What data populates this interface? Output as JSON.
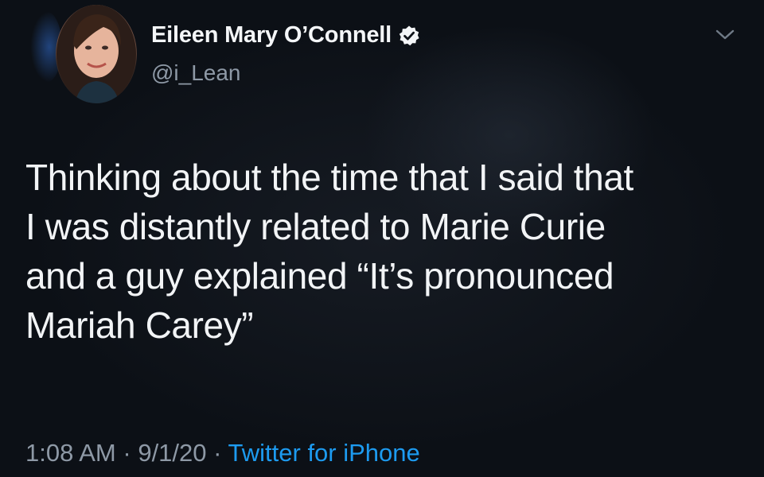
{
  "author": {
    "display_name": "Eileen Mary O’Connell",
    "handle": "@i_Lean",
    "verified": true
  },
  "tweet": {
    "lines": [
      "Thinking about the time that I said that",
      "I was distantly related to Marie Curie",
      "and a guy explained “It’s pronounced",
      "Mariah Carey”"
    ]
  },
  "meta": {
    "time": "1:08 AM",
    "separator": "·",
    "date": "9/1/20",
    "source": "Twitter for iPhone"
  },
  "colors": {
    "background": "#10141a",
    "text": "#f2f4f6",
    "secondary_text": "#8e99a6",
    "link": "#1d9bf0"
  },
  "icons": {
    "verified": "verified-badge-icon",
    "menu": "chevron-down-icon"
  }
}
